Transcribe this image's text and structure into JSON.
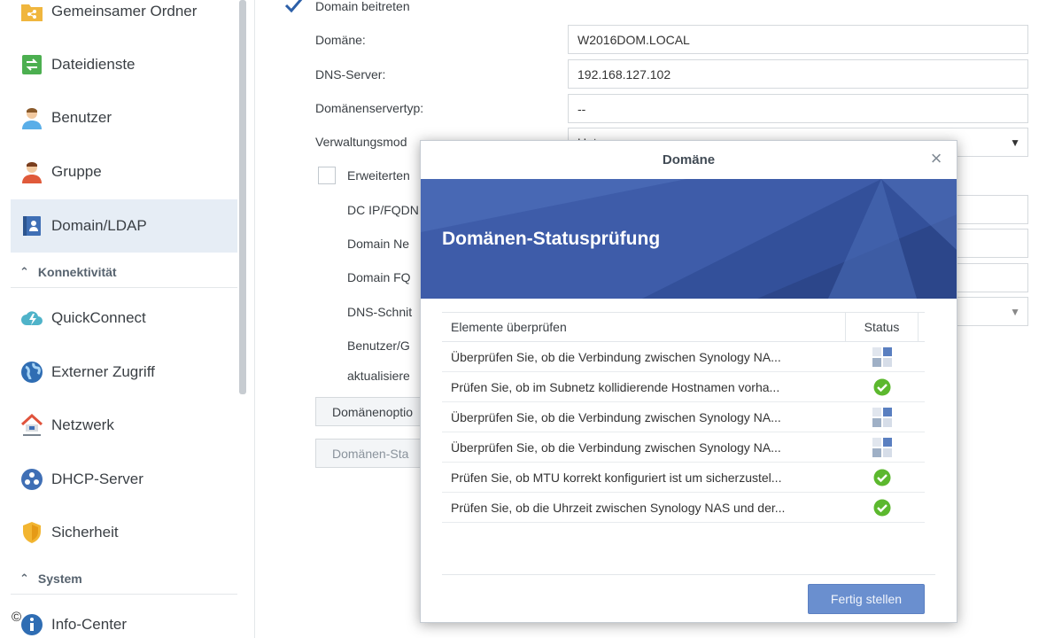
{
  "sidebar": {
    "items": [
      {
        "label": "Gemeinsamer Ordner",
        "icon": "shared-folder-icon"
      },
      {
        "label": "Dateidienste",
        "icon": "file-services-icon"
      },
      {
        "label": "Benutzer",
        "icon": "user-icon"
      },
      {
        "label": "Gruppe",
        "icon": "group-icon"
      },
      {
        "label": "Domain/LDAP",
        "icon": "domain-ldap-icon",
        "active": true
      },
      {
        "label": "QuickConnect",
        "icon": "quickconnect-icon"
      },
      {
        "label": "Externer Zugriff",
        "icon": "globe-icon"
      },
      {
        "label": "Netzwerk",
        "icon": "network-house-icon"
      },
      {
        "label": "DHCP-Server",
        "icon": "dhcp-icon"
      },
      {
        "label": "Sicherheit",
        "icon": "shield-icon"
      },
      {
        "label": "Info-Center",
        "icon": "info-icon"
      }
    ],
    "sections": {
      "connectivity": "Konnektivität",
      "system": "System"
    }
  },
  "form": {
    "join_domain_label": "Domain beitreten",
    "domain_label": "Domäne:",
    "domain_value": "W2016DOM.LOCAL",
    "dns_label": "DNS-Server:",
    "dns_value": "192.168.127.102",
    "server_type_label": "Domänenservertyp:",
    "server_type_value": "--",
    "mgmt_mode_label": "Verwaltungsmod",
    "mgmt_mode_value": "Unt",
    "advanced_label": "Erweiterten",
    "dc_ip_label": "DC IP/FQDN",
    "domain_netbios_label": "Domain Ne",
    "domain_fqdn_label": "Domain FQ",
    "dns_interface_label": "DNS-Schnit",
    "users_groups_label": "Benutzer/G",
    "update_label": "aktualisiere",
    "domain_options_button": "Domänenoptio",
    "domain_status_button": "Domänen-Sta"
  },
  "dialog": {
    "title": "Domäne",
    "banner_title": "Domänen-Statusprüfung",
    "col_items": "Elemente überprüfen",
    "col_status": "Status",
    "rows": [
      {
        "text": "Überprüfen Sie, ob die Verbindung zwischen Synology NA...",
        "status": "pending"
      },
      {
        "text": "Prüfen Sie, ob im Subnetz kollidierende Hostnamen vorha...",
        "status": "ok"
      },
      {
        "text": "Überprüfen Sie, ob die Verbindung zwischen Synology NA...",
        "status": "pending"
      },
      {
        "text": "Überprüfen Sie, ob die Verbindung zwischen Synology NA...",
        "status": "pending"
      },
      {
        "text": "Prüfen Sie, ob MTU korrekt konfiguriert ist um sicherzustel...",
        "status": "ok"
      },
      {
        "text": "Prüfen Sie, ob die Uhrzeit zwischen Synology NAS und der...",
        "status": "ok"
      }
    ],
    "finish_button": "Fertig stellen"
  },
  "copyright": "©",
  "colors": {
    "accent": "#3c5aa8",
    "ok": "#5cb82e",
    "pending": "#9fb0c6",
    "finish_button": "#6a8fcf"
  }
}
